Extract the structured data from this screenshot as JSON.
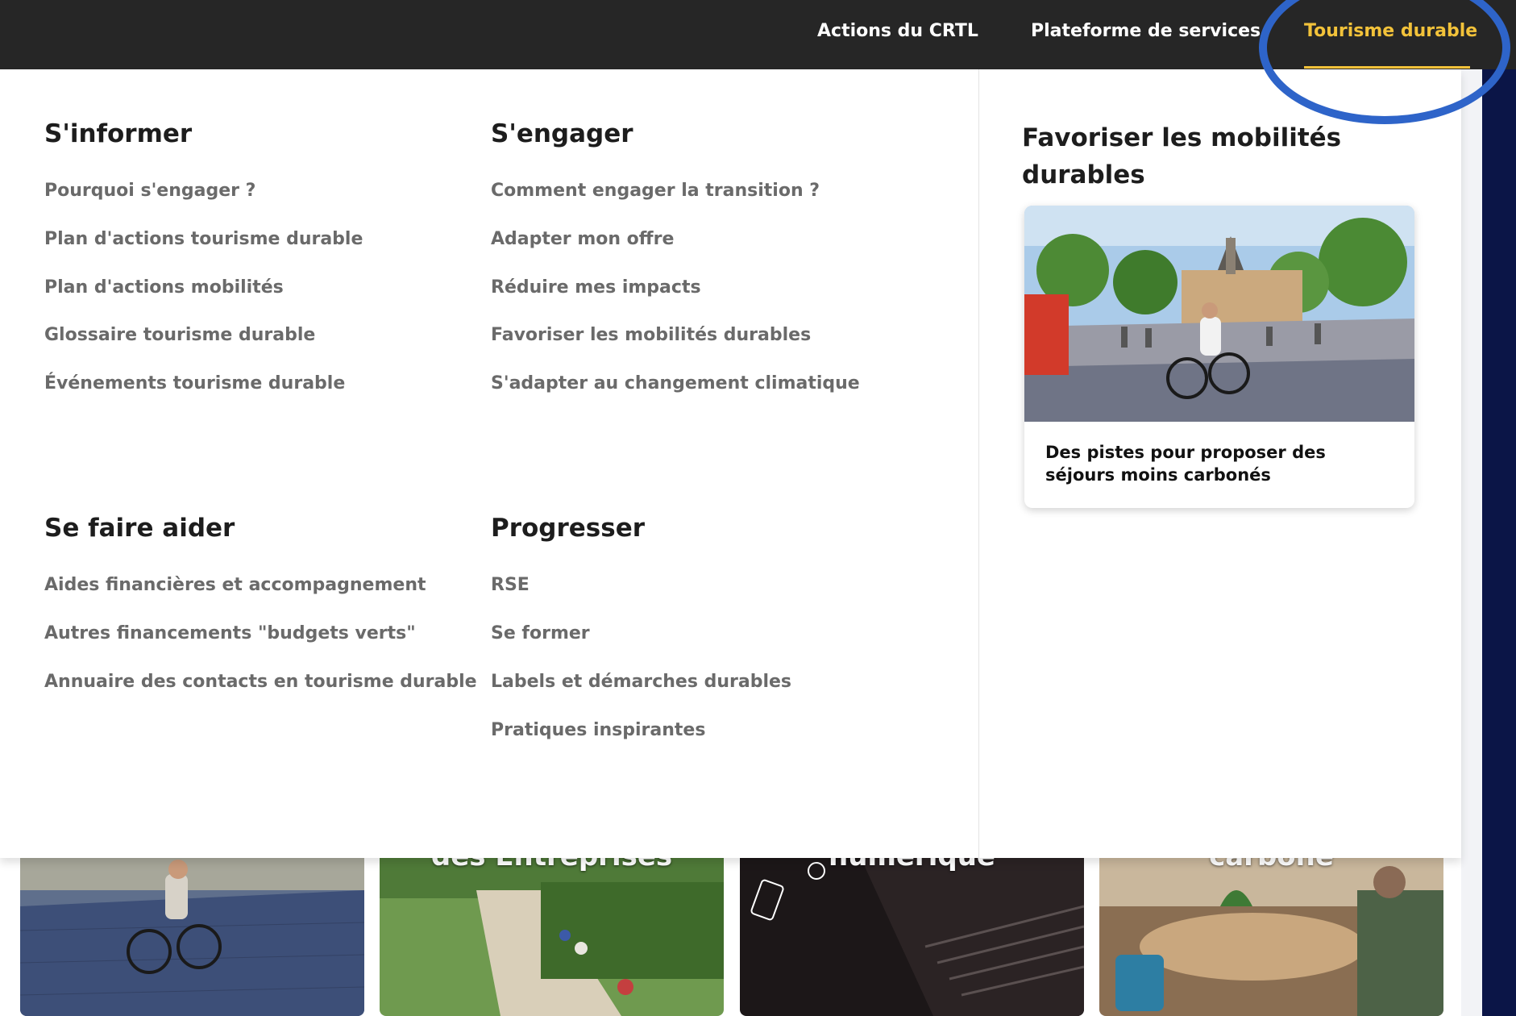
{
  "topnav": {
    "items": [
      {
        "label": "Actions du CRTL",
        "active": false
      },
      {
        "label": "Plateforme de services",
        "active": false
      },
      {
        "label": "Tourisme durable",
        "active": true
      }
    ]
  },
  "menu": {
    "columns": [
      {
        "title": "S'informer",
        "links": [
          "Pourquoi s'engager ?",
          "Plan d'actions tourisme durable",
          "Plan d'actions mobilités",
          "Glossaire tourisme durable",
          "Événements tourisme durable"
        ]
      },
      {
        "title": "S'engager",
        "links": [
          "Comment engager la transition ?",
          "Adapter mon offre",
          "Réduire mes impacts",
          "Favoriser les mobilités durables",
          "S'adapter au changement climatique"
        ]
      },
      {
        "title": "Se faire aider",
        "links": [
          "Aides financières et accompagnement",
          "Autres financements \"budgets verts\"",
          "Annuaire des contacts en tourisme durable"
        ]
      },
      {
        "title": "Progresser",
        "links": [
          "RSE",
          "Se former",
          "Labels et démarches durables",
          "Pratiques inspirantes"
        ]
      }
    ]
  },
  "feature": {
    "title": "Favoriser les mobilités durables",
    "card_caption": "Des pistes pour proposer des séjours moins carbonés"
  },
  "tiles": [
    {
      "label": ""
    },
    {
      "label": "des Entreprises"
    },
    {
      "label": "numérique"
    },
    {
      "label": "carbone"
    }
  ],
  "colors": {
    "topbar": "#262626",
    "active_accent": "#f2c23a",
    "highlight_ring": "#2e64c9",
    "side_band": "#0b1547"
  }
}
